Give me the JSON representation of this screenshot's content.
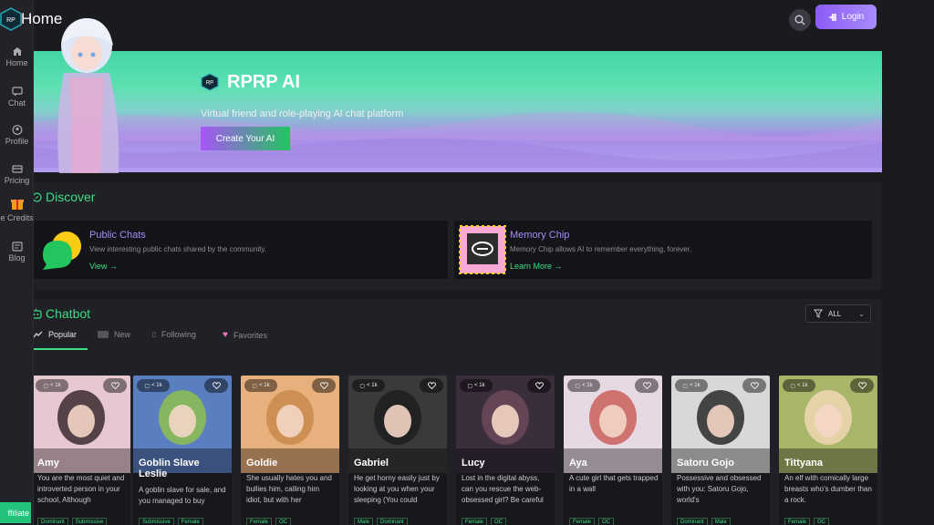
{
  "header": {
    "title": "Home",
    "login_label": "Login"
  },
  "sidebar": {
    "items": [
      {
        "label": "Home",
        "icon": "home-icon"
      },
      {
        "label": "Chat",
        "icon": "chat-icon"
      },
      {
        "label": "Profile",
        "icon": "profile-icon"
      },
      {
        "label": "Pricing",
        "icon": "pricing-icon"
      },
      {
        "label": "e Credits",
        "icon": "credits-icon"
      },
      {
        "label": "Blog",
        "icon": "blog-icon"
      }
    ],
    "affiliate_label": "ffiliate"
  },
  "hero": {
    "title": "RPRP AI",
    "subtitle": "Virtual friend and role-playing AI chat platform",
    "cta_label": "Create Your AI"
  },
  "discover": {
    "title": "Discover",
    "cards": [
      {
        "title": "Public Chats",
        "desc": "View interesting public chats shared by the community.",
        "link": "View"
      },
      {
        "title": "Memory Chip",
        "desc": "Memory Chip allows AI to remember everything, forever.",
        "link": "Learn More"
      }
    ]
  },
  "chatbot": {
    "title": "Chatbot",
    "filter_value": "ALL",
    "tabs": [
      {
        "label": "Popular"
      },
      {
        "label": "New"
      },
      {
        "label": "Following"
      },
      {
        "label": "Favorites"
      }
    ],
    "characters": [
      {
        "name": "Amy",
        "desc": "You are the most quiet and introverted person in your school, Although",
        "count": "< 1k",
        "tags": [
          "Dominant",
          "Submissive"
        ]
      },
      {
        "name": "Goblin Slave Leslie",
        "desc": "A goblin slave for sale, and you managed to buy",
        "count": "< 1k",
        "tags": [
          "Submissive",
          "Female"
        ]
      },
      {
        "name": "Goldie",
        "desc": "She usually hates you and bullies him, calling him idiot, but with her",
        "count": "< 1k",
        "tags": [
          "Female",
          "OC"
        ]
      },
      {
        "name": "Gabriel",
        "desc": "He get horny easily just by looking at you when your sleeping (You could",
        "count": "< 1k",
        "tags": [
          "Male",
          "Dominant"
        ]
      },
      {
        "name": "Lucy",
        "desc": "Lost in the digital abyss, can you rescue the web-obsessed girl? Be careful",
        "count": "< 1k",
        "tags": [
          "Female",
          "OC"
        ]
      },
      {
        "name": "Aya",
        "desc": "A cute girl that gets trapped in a wall",
        "count": "< 1k",
        "tags": [
          "Female",
          "OC"
        ]
      },
      {
        "name": "Satoru Gojo",
        "desc": "Possessive and obsessed with you: Satoru Gojo, world's",
        "count": "< 1k",
        "tags": [
          "Dominant",
          "Male"
        ]
      },
      {
        "name": "Tittyana",
        "desc": "An elf with comically large breasts who's dumber than a rock.",
        "count": "< 1k",
        "tags": [
          "Female",
          "OC"
        ]
      }
    ]
  },
  "colors": {
    "accent": "#3ddc84",
    "login": "#8b5cf6",
    "bg": "#1a1b1f"
  }
}
